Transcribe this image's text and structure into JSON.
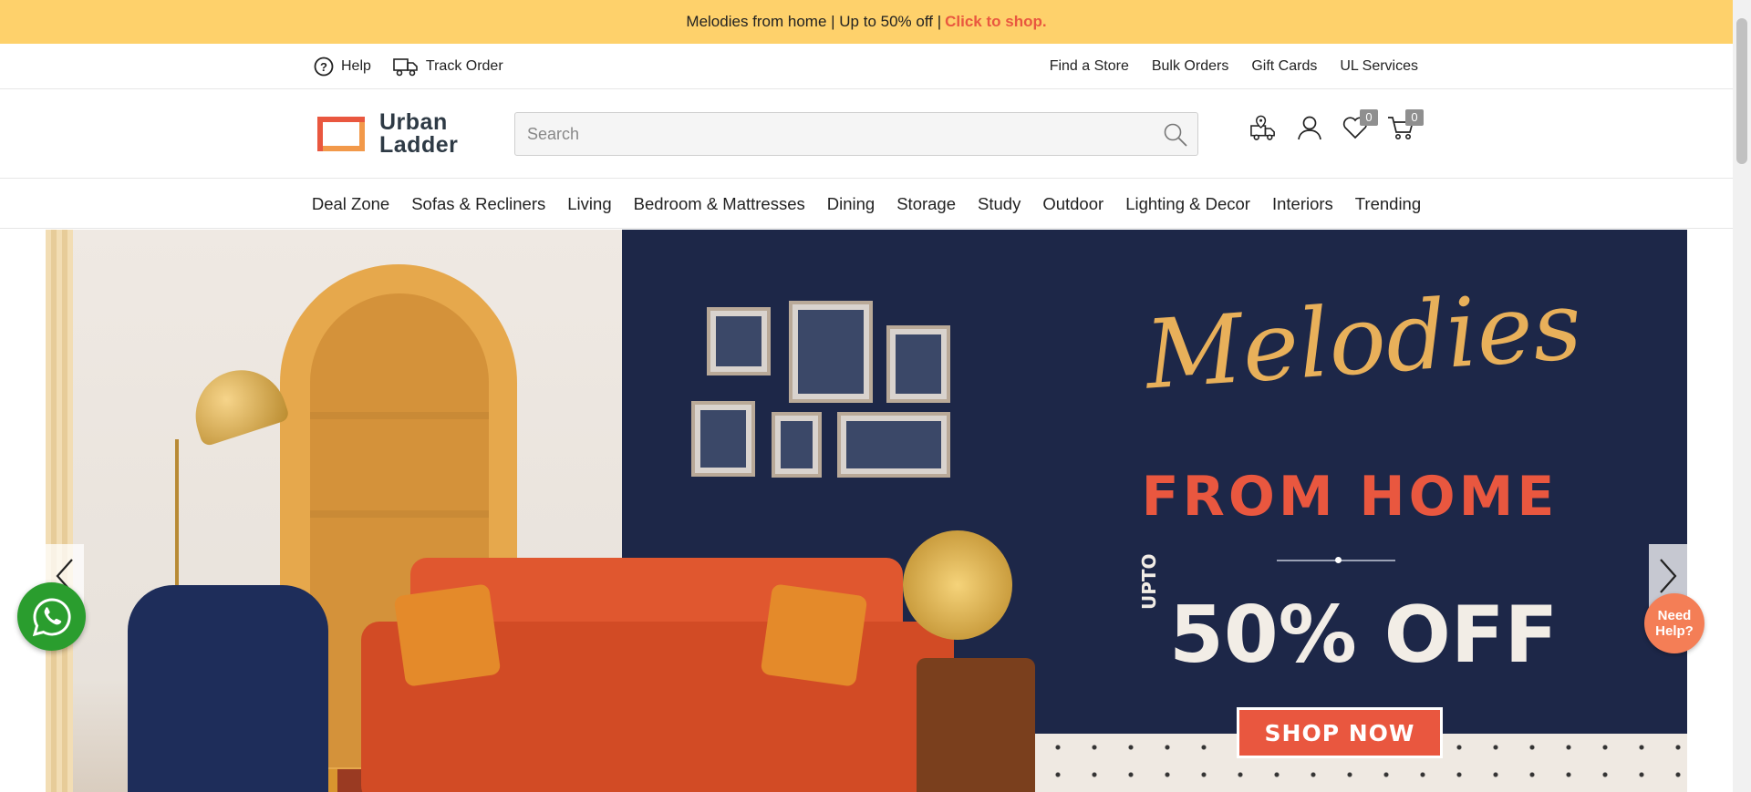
{
  "promo": {
    "text": "Melodies from home | Up to 50% off |",
    "cta": "Click to shop."
  },
  "util_left": [
    {
      "label": "Help",
      "icon": "help-icon"
    },
    {
      "label": "Track Order",
      "icon": "track-order-icon"
    }
  ],
  "util_right": [
    "Find a Store",
    "Bulk Orders",
    "Gift Cards",
    "UL Services"
  ],
  "logo": {
    "line1": "Urban",
    "line2": "Ladder",
    "color": "#E9573F"
  },
  "search": {
    "placeholder": "Search"
  },
  "header_icons": {
    "store_locator": "store-locator-icon",
    "account": "user-icon",
    "wishlist_count": "0",
    "cart_count": "0"
  },
  "nav": [
    "Deal Zone",
    "Sofas & Recliners",
    "Living",
    "Bedroom & Mattresses",
    "Dining",
    "Storage",
    "Study",
    "Outdoor",
    "Lighting & Decor",
    "Interiors",
    "Trending"
  ],
  "hero": {
    "title": "Melodies",
    "subtitle": "FROM HOME",
    "upto": "UPTO",
    "discount": "50% OFF",
    "cta": "SHOP NOW",
    "background_color": "#1d2748",
    "accent": "#E9573F"
  },
  "need_help": {
    "line1": "Need",
    "line2": "Help?"
  },
  "colors": {
    "promo_bg": "#FED16B",
    "brand_orange": "#E9573F",
    "whatsapp": "#2A9D2E"
  }
}
